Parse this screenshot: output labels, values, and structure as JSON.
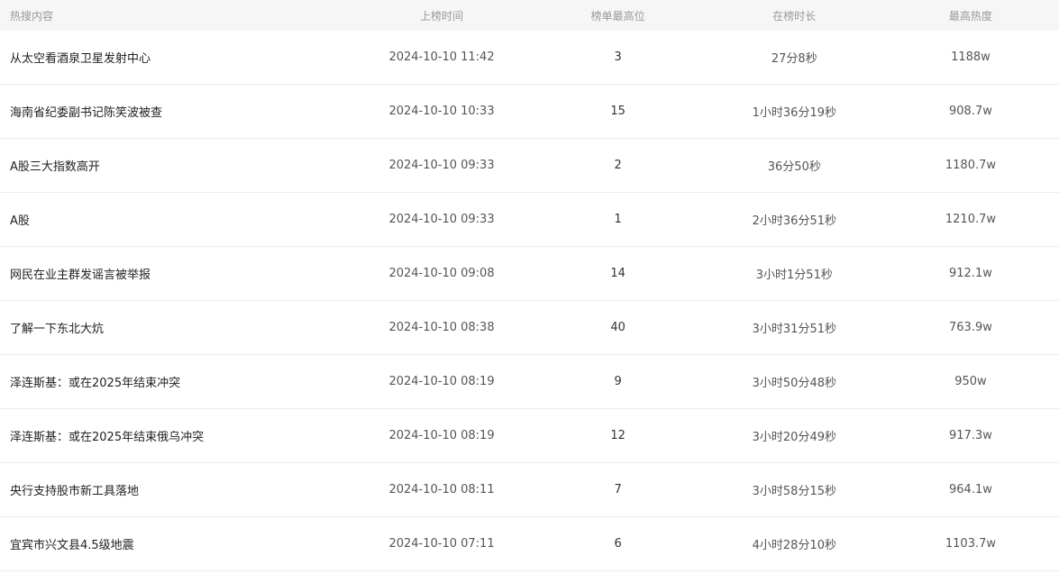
{
  "header": {
    "title": "热搜内容",
    "time": "上榜时间",
    "rank": "榜单最高位",
    "duration": "在榜时长",
    "heat": "最高热度"
  },
  "rows": [
    {
      "title": "从太空看酒泉卫星发射中心",
      "time": "2024-10-10 11:42",
      "rank": "3",
      "duration": "27分8秒",
      "heat": "1188w"
    },
    {
      "title": "海南省纪委副书记陈笑波被查",
      "time": "2024-10-10 10:33",
      "rank": "15",
      "duration": "1小时36分19秒",
      "heat": "908.7w"
    },
    {
      "title": "A股三大指数高开",
      "time": "2024-10-10 09:33",
      "rank": "2",
      "duration": "36分50秒",
      "heat": "1180.7w"
    },
    {
      "title": "A股",
      "time": "2024-10-10 09:33",
      "rank": "1",
      "duration": "2小时36分51秒",
      "heat": "1210.7w"
    },
    {
      "title": "网民在业主群发谣言被举报",
      "time": "2024-10-10 09:08",
      "rank": "14",
      "duration": "3小时1分51秒",
      "heat": "912.1w"
    },
    {
      "title": "了解一下东北大炕",
      "time": "2024-10-10 08:38",
      "rank": "40",
      "duration": "3小时31分51秒",
      "heat": "763.9w"
    },
    {
      "title": "泽连斯基：或在2025年结束冲突",
      "time": "2024-10-10 08:19",
      "rank": "9",
      "duration": "3小时50分48秒",
      "heat": "950w"
    },
    {
      "title": "泽连斯基：或在2025年结束俄乌冲突",
      "time": "2024-10-10 08:19",
      "rank": "12",
      "duration": "3小时20分49秒",
      "heat": "917.3w"
    },
    {
      "title": "央行支持股市新工具落地",
      "time": "2024-10-10 08:11",
      "rank": "7",
      "duration": "3小时58分15秒",
      "heat": "964.1w"
    },
    {
      "title": "宜宾市兴文县4.5级地震",
      "time": "2024-10-10 07:11",
      "rank": "6",
      "duration": "4小时28分10秒",
      "heat": "1103.7w"
    }
  ]
}
